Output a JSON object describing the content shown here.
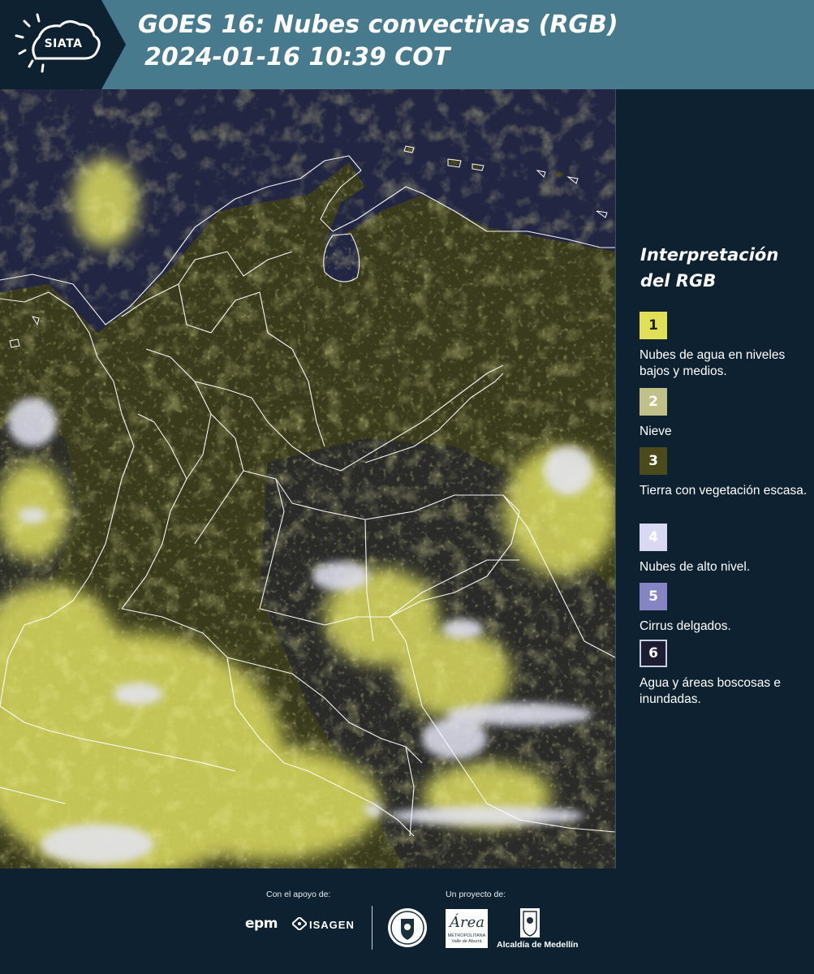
{
  "header": {
    "logo_text": "SIATA",
    "title": "GOES 16: Nubes convectivas (RGB)",
    "subtitle": "2024-01-16 10:39 COT"
  },
  "map": {
    "image_description_colors": {
      "ocean_water": "#232642",
      "land_low_veg": "#3b3d1c",
      "low_clouds": "#e4e46a",
      "high_clouds": "#d9d9ee",
      "borders": "#ffffff"
    }
  },
  "legend": {
    "title": "Interpretación del RGB",
    "items": [
      {
        "number": "1",
        "label": "Nubes de agua en niveles bajos y medios.",
        "color": "#e0e056",
        "text_color": "#1c2030"
      },
      {
        "number": "2",
        "label": "Nieve",
        "color": "#c0c088",
        "text_color": "#ffffff"
      },
      {
        "number": "3",
        "label": "Tierra con vegetación escasa.",
        "color": "#4a4a1c",
        "text_color": "#ffffff"
      },
      {
        "number": "4",
        "label": "Nubes de alto nivel.",
        "color": "#d9d9f3",
        "text_color": "#ffffff"
      },
      {
        "number": "5",
        "label": "Cirrus delgados.",
        "color": "#8585c3",
        "text_color": "#ffffff"
      },
      {
        "number": "6",
        "label": "Agua y áreas boscosas e inundadas.",
        "color": "#1c1c33",
        "text_color": "#ffffff"
      }
    ]
  },
  "footer": {
    "support_label": "Con el apoyo de:",
    "project_label": "Un proyecto de:",
    "sponsor_1": "epm",
    "sponsor_2": "ISAGEN",
    "area_script": "Área",
    "area_line_1": "METROPOLITANA",
    "area_line_2": "Valle de Aburrá",
    "alcaldia": "Alcaldía de Medellín"
  }
}
